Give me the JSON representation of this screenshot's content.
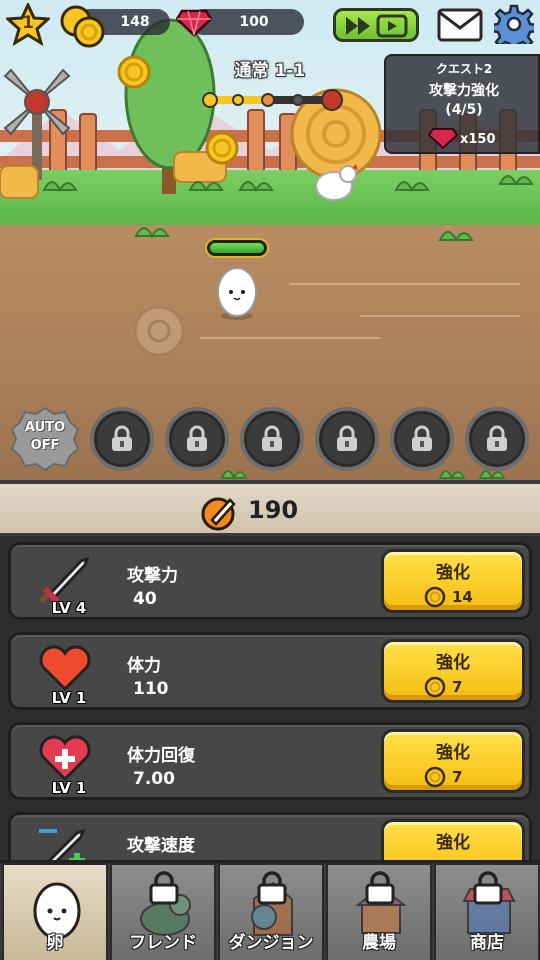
{
  "hud": {
    "level": "1",
    "coins": "148",
    "gems": "100"
  },
  "stage": {
    "title": "通常 1-1"
  },
  "quest": {
    "title": "クエスト2",
    "name": "攻撃力強化",
    "progress": "(4/5)",
    "reward": "x150"
  },
  "auto": {
    "line1": "AUTO",
    "line2": "OFF"
  },
  "skill_slots_locked": 6,
  "power": {
    "value": "190"
  },
  "upgrades": [
    {
      "name": "攻撃力",
      "level": "LV 4",
      "value": "40",
      "button": "強化",
      "cost": "14"
    },
    {
      "name": "体力",
      "level": "LV 1",
      "value": "110",
      "button": "強化",
      "cost": "7"
    },
    {
      "name": "体力回復",
      "level": "LV 1",
      "value": "7.00",
      "button": "強化",
      "cost": "7"
    },
    {
      "name": "攻撃速度",
      "level": "",
      "value": "",
      "button": "強化",
      "cost": ""
    }
  ],
  "nav": [
    {
      "label": "卵",
      "active": true
    },
    {
      "label": "フレンド",
      "locked": true
    },
    {
      "label": "ダンジョン",
      "locked": true
    },
    {
      "label": "農場",
      "locked": true
    },
    {
      "label": "商店",
      "locked": true
    }
  ],
  "colors": {
    "accent_yellow": "#f5bd10",
    "speed_green": "#6cc233",
    "gem_red": "#d6284a",
    "panel_dark": "#474747"
  }
}
